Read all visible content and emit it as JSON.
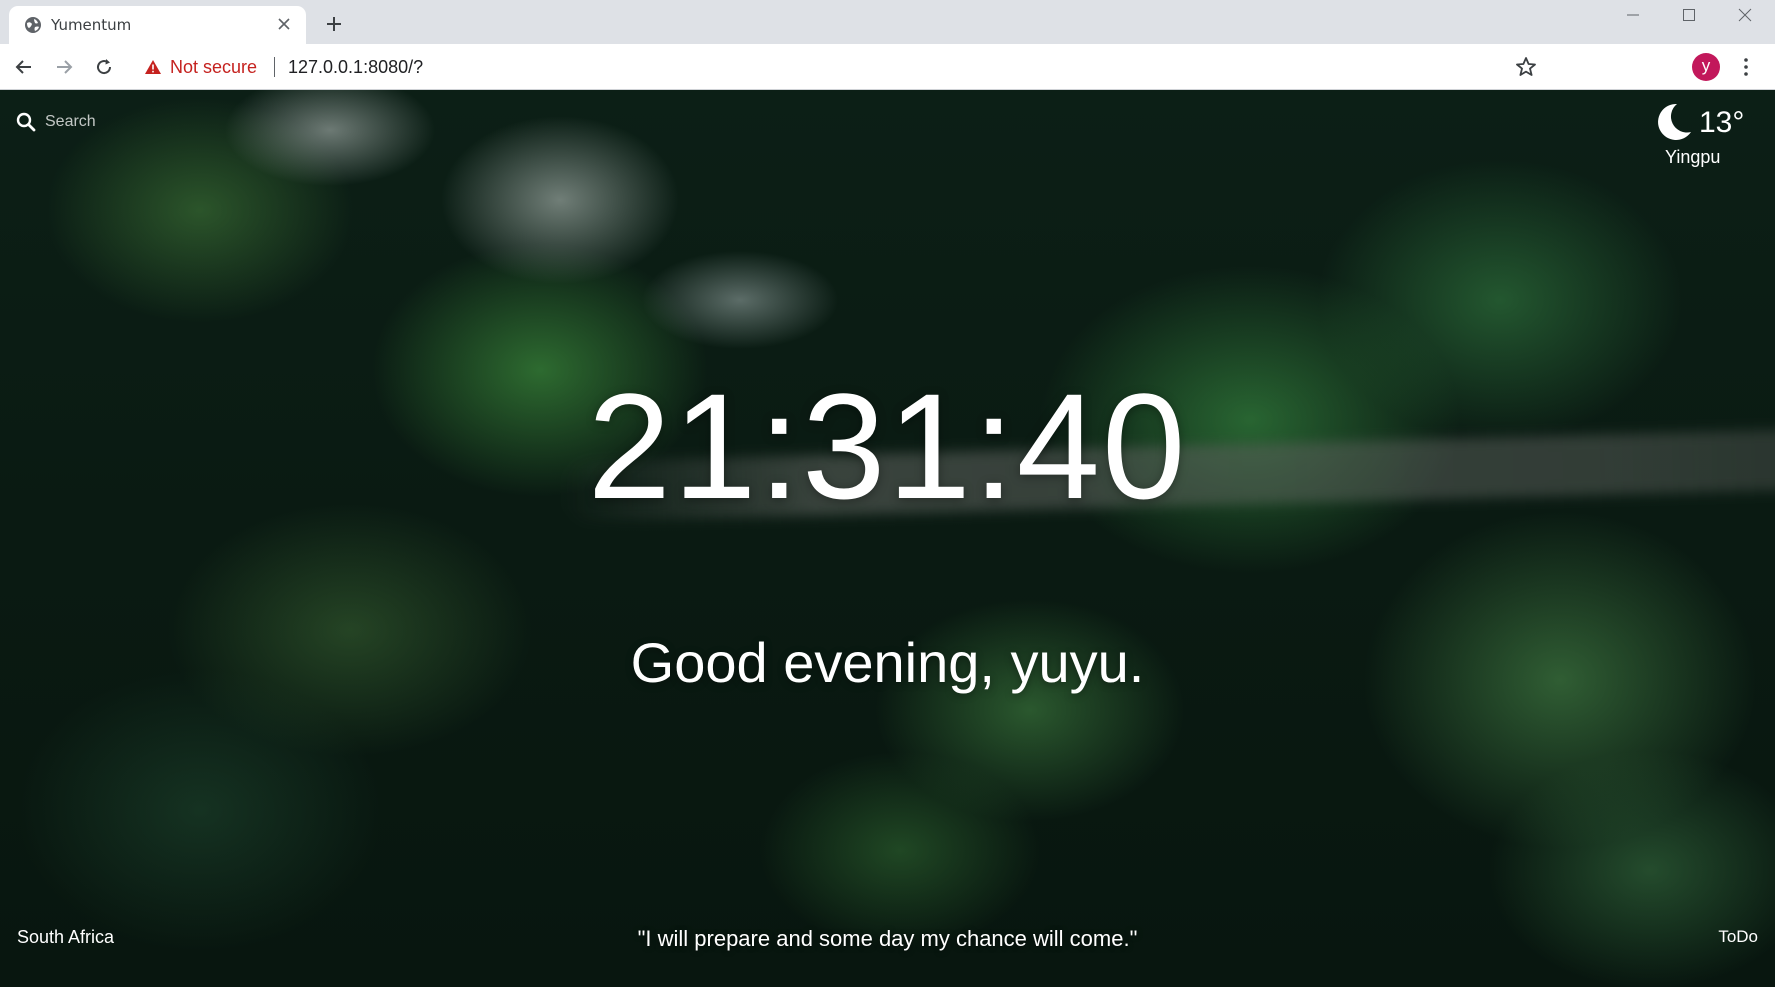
{
  "browser": {
    "tab": {
      "title": "Yumentum",
      "favicon": "globe-icon"
    },
    "address_bar": {
      "security_label": "Not secure",
      "url": "127.0.0.1:8080/?"
    },
    "profile_initial": "y"
  },
  "page": {
    "search": {
      "label": "Search",
      "icon": "search-icon"
    },
    "weather": {
      "temperature": "13°",
      "location": "Yingpu",
      "icon": "moon-icon"
    },
    "clock": "21:31:40",
    "greeting": "Good evening, yuyu.",
    "photo_location": "South Africa",
    "quote": "\"I will prepare and some day my chance will come.\"",
    "todo_label": "ToDo"
  }
}
